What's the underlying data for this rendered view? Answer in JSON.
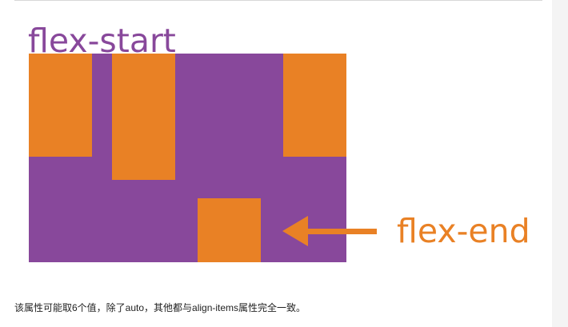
{
  "figure": {
    "colors": {
      "container": "#88489b",
      "item": "#e98125",
      "start_label": "#88489b",
      "end_label": "#e98125"
    },
    "labels": {
      "start": "flex-start",
      "end": "flex-end"
    }
  },
  "description": {
    "text": "该属性可能取6个值，除了auto，其他都与align-items属性完全一致。"
  }
}
